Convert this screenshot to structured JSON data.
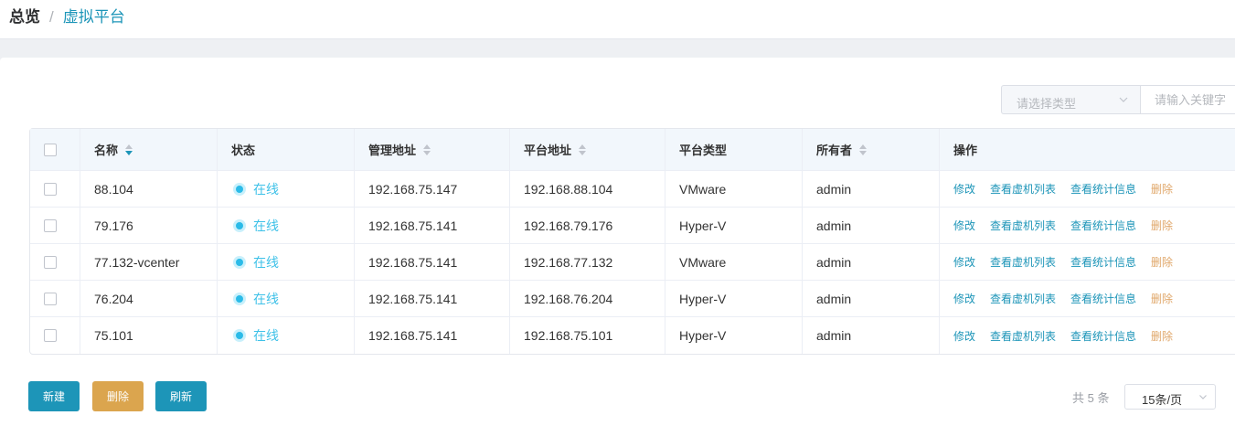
{
  "breadcrumb": {
    "home": "总览",
    "separator": "/",
    "current": "虚拟平台"
  },
  "filter": {
    "type_placeholder": "请选择类型",
    "keyword_placeholder": "请输入关键字"
  },
  "table": {
    "headers": {
      "name": "名称",
      "status": "状态",
      "mgmt": "管理地址",
      "plat": "平台地址",
      "type": "平台类型",
      "owner": "所有者",
      "ops": "操作"
    },
    "rows": [
      {
        "name": "88.104",
        "status": "在线",
        "mgmt": "192.168.75.147",
        "plat": "192.168.88.104",
        "type": "VMware",
        "owner": "admin"
      },
      {
        "name": "79.176",
        "status": "在线",
        "mgmt": "192.168.75.141",
        "plat": "192.168.79.176",
        "type": "Hyper-V",
        "owner": "admin"
      },
      {
        "name": "77.132-vcenter",
        "status": "在线",
        "mgmt": "192.168.75.141",
        "plat": "192.168.77.132",
        "type": "VMware",
        "owner": "admin"
      },
      {
        "name": "76.204",
        "status": "在线",
        "mgmt": "192.168.75.141",
        "plat": "192.168.76.204",
        "type": "Hyper-V",
        "owner": "admin"
      },
      {
        "name": "75.101",
        "status": "在线",
        "mgmt": "192.168.75.141",
        "plat": "192.168.75.101",
        "type": "Hyper-V",
        "owner": "admin"
      }
    ],
    "ops": {
      "edit": "修改",
      "vm_list": "查看虚机列表",
      "stats": "查看统计信息",
      "delete": "删除"
    }
  },
  "buttons": {
    "new": "新建",
    "delete": "删除",
    "refresh": "刷新"
  },
  "pagination": {
    "total": "共 5 条",
    "page_size": "15条/页"
  },
  "colors": {
    "accent": "#1d95b8",
    "online": "#2bbbe8",
    "delete": "#dba54e",
    "header_bg": "#f2f7fc"
  }
}
